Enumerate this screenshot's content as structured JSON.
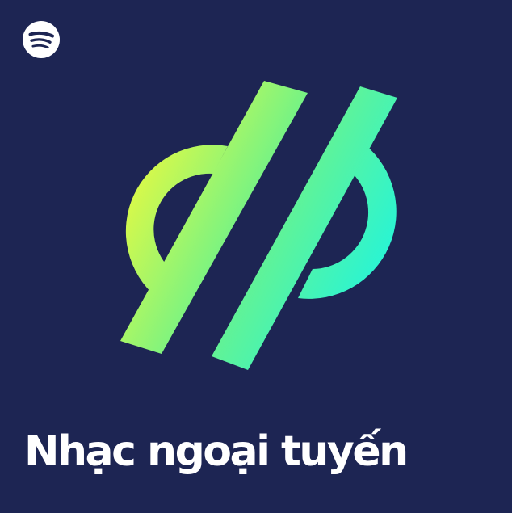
{
  "cover": {
    "title": "Nhạc ngoại tuyến",
    "background_color": "#1d2553",
    "title_color": "#ffffff",
    "brand_icon": "spotify-logo-icon",
    "artwork_icon": "offline-download-symbol-icon",
    "gradient": {
      "start_color": "#f2fb3a",
      "mid_color": "#6cf28a",
      "end_color": "#0ef6f2"
    }
  }
}
